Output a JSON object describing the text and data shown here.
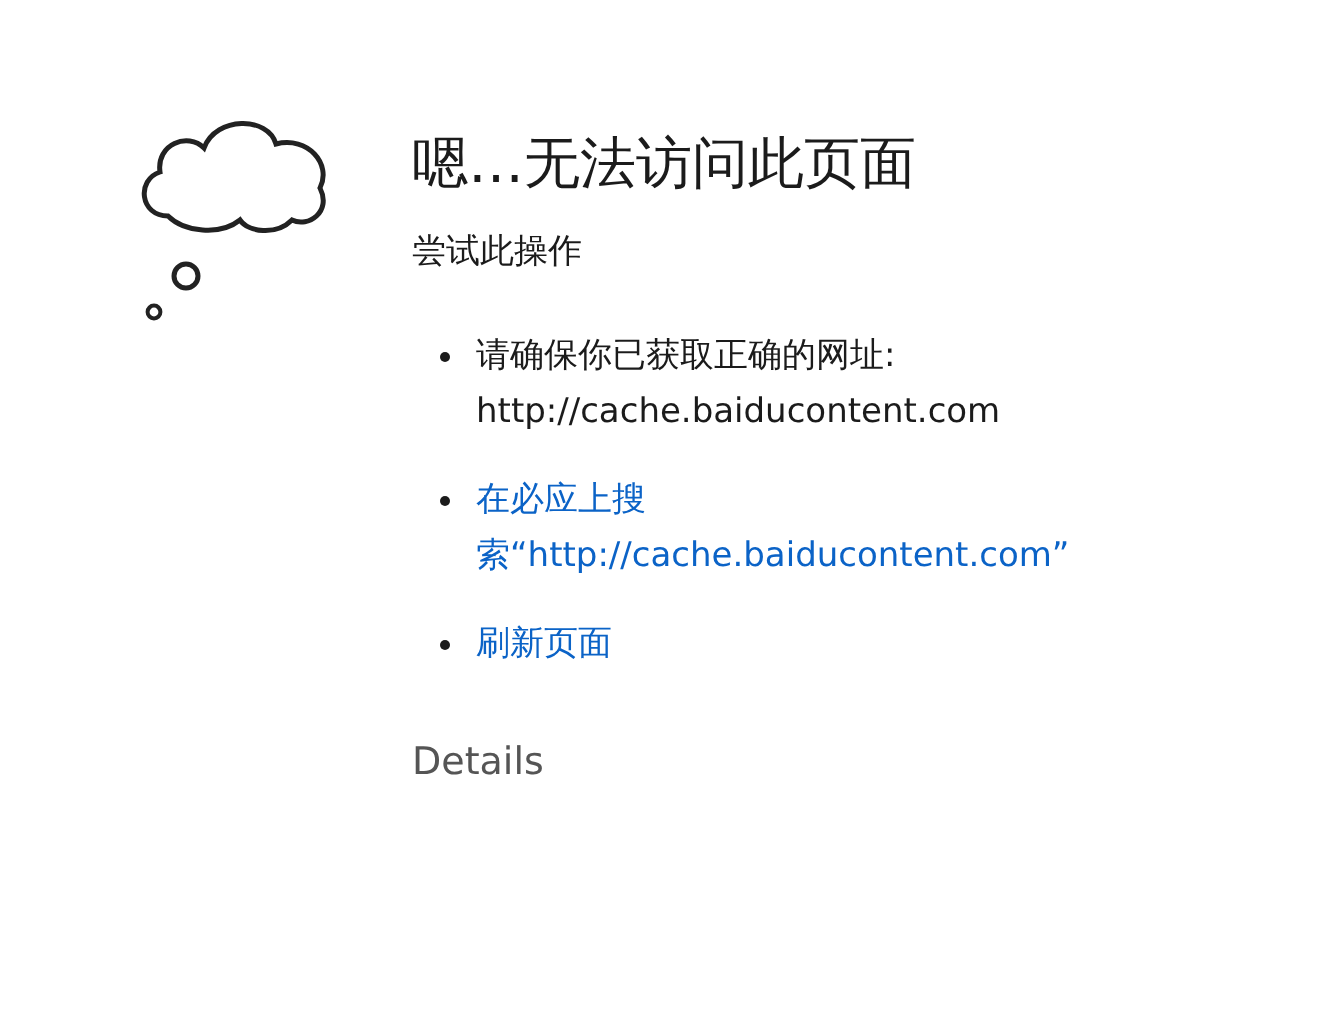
{
  "title": "嗯…无法访问此页面",
  "subtitle": "尝试此操作",
  "suggestions": [
    {
      "kind": "text",
      "text": "请确保你已获取正确的网址:",
      "detail": "http://cache.baiducontent.com"
    },
    {
      "kind": "link",
      "text": "在必应上搜索“http://cache.baiducontent.com”"
    },
    {
      "kind": "link",
      "text": "刷新页面"
    }
  ],
  "details_button": "Details"
}
